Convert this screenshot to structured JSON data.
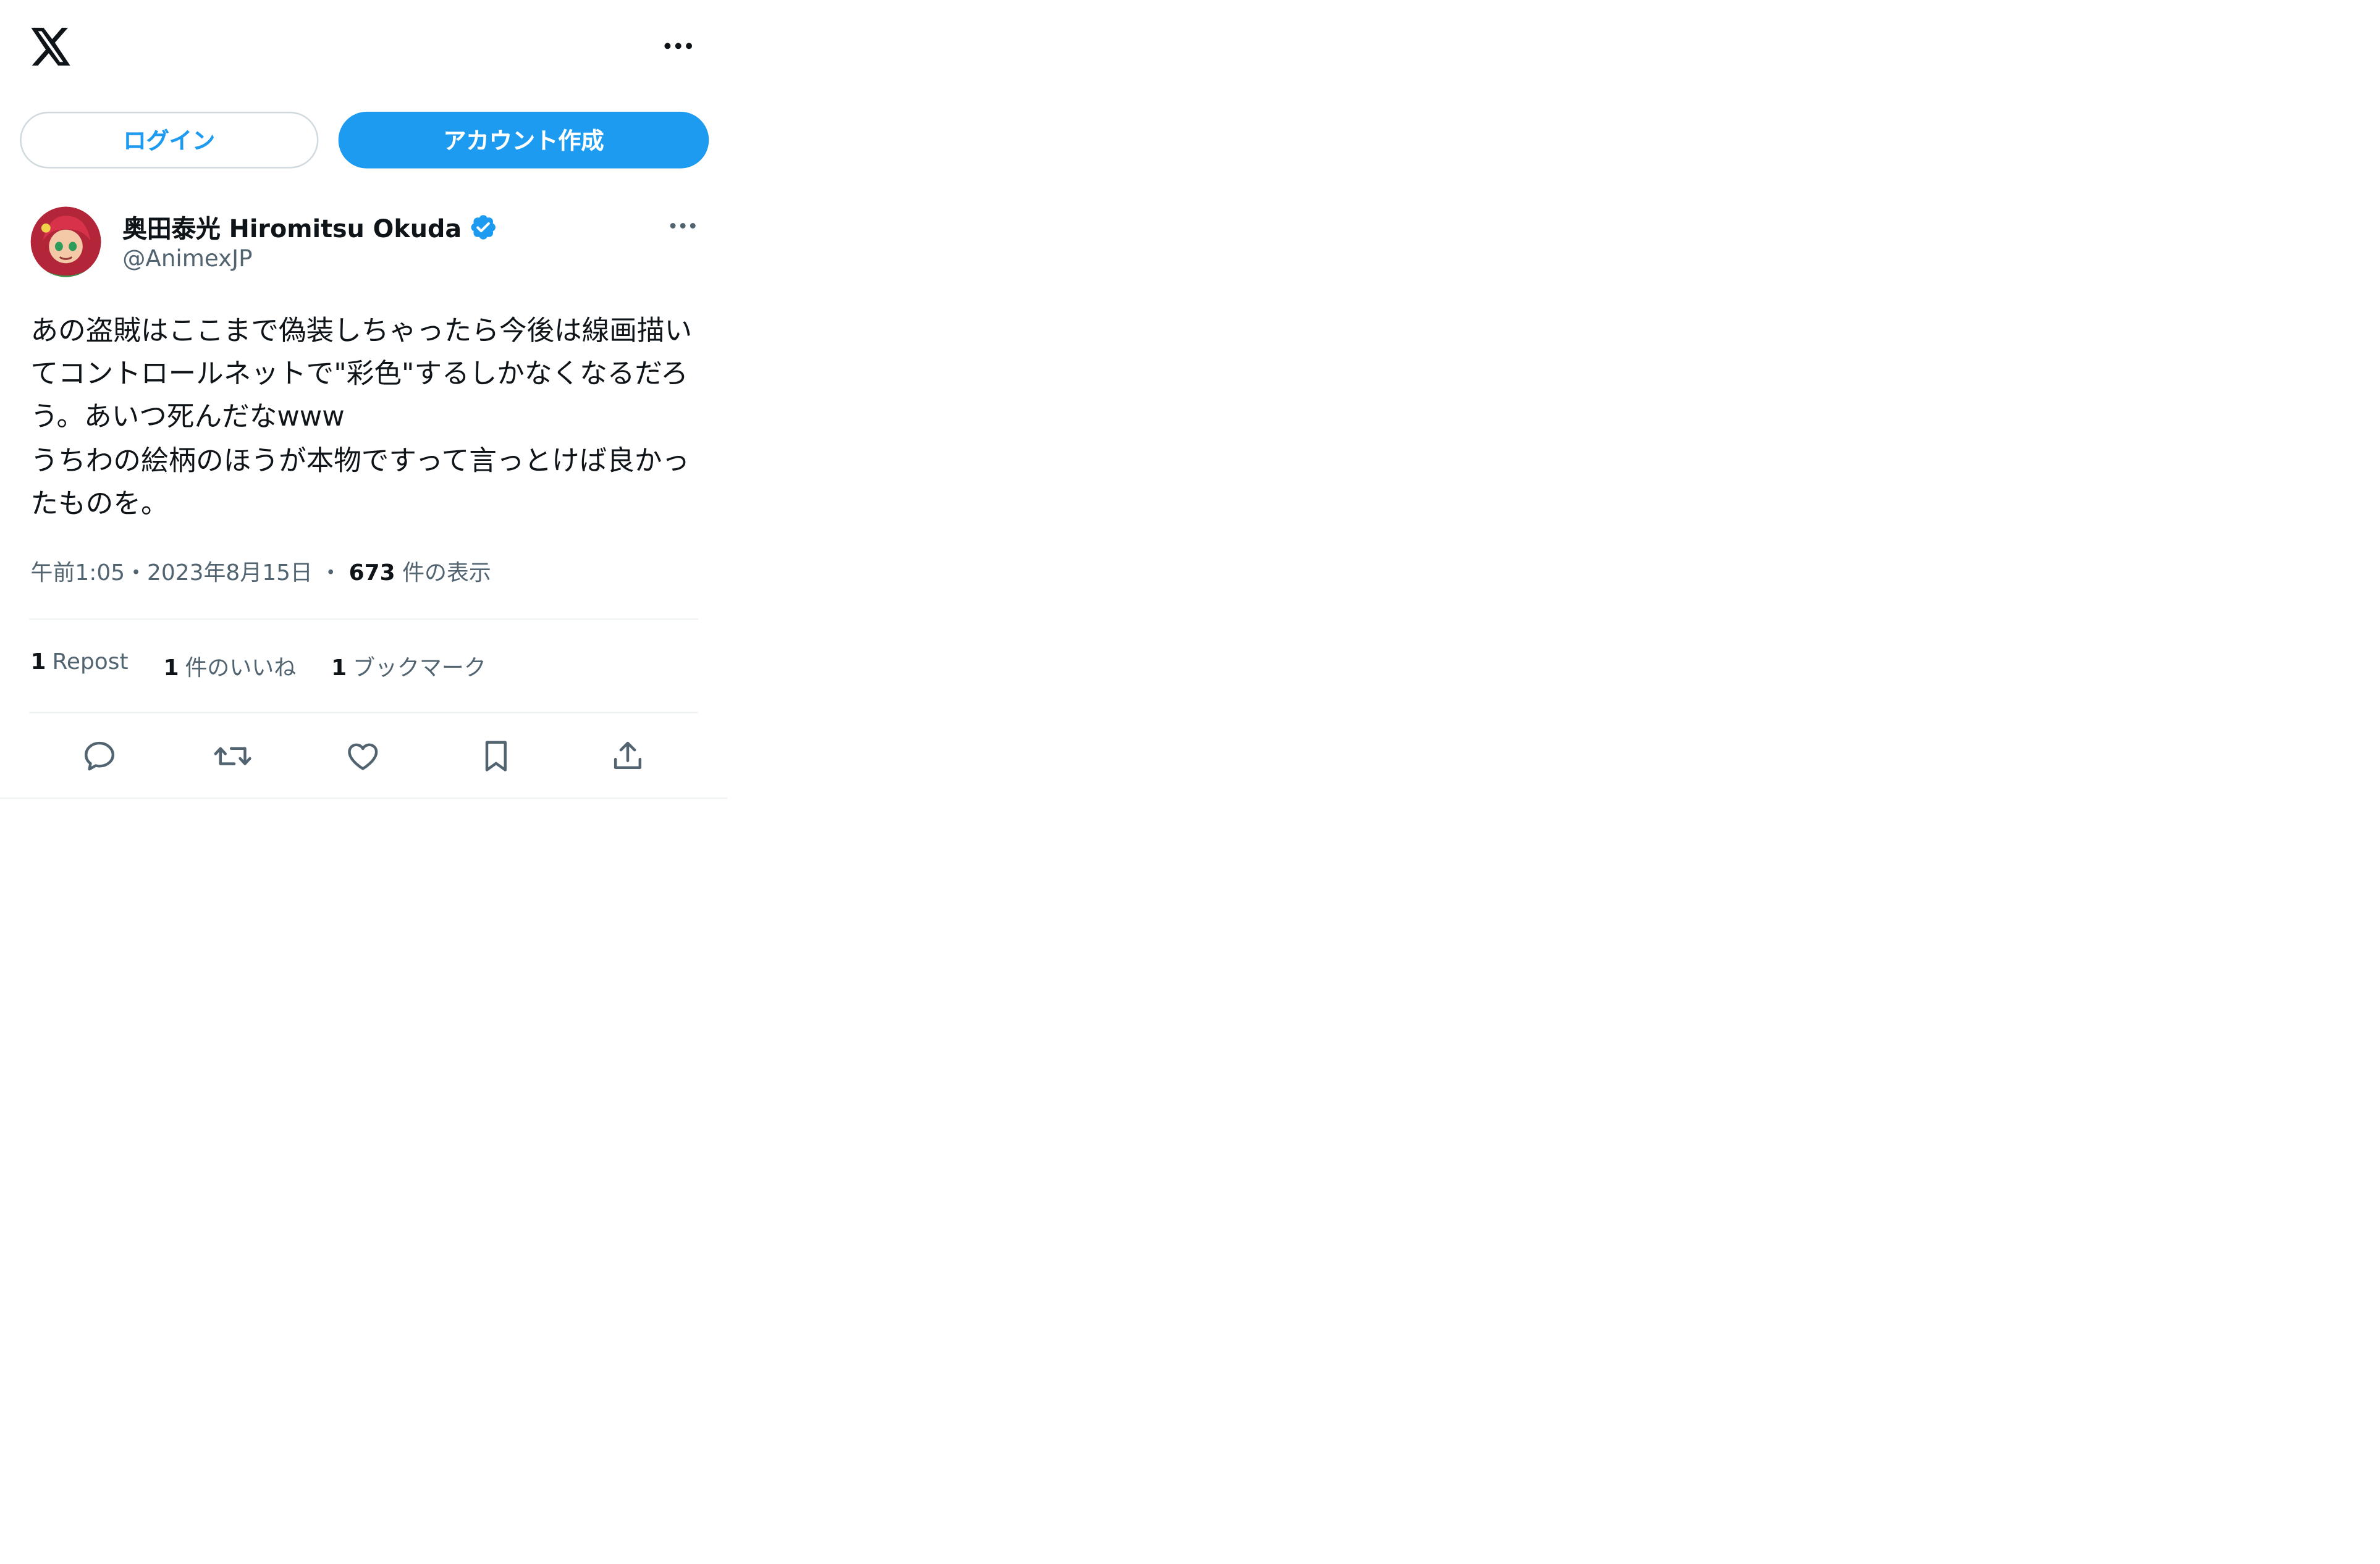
{
  "header": {
    "logo_icon": "x-logo-icon",
    "more_icon": "more-horizontal-icon"
  },
  "auth": {
    "login_label": "ログイン",
    "signup_label": "アカウント作成"
  },
  "post": {
    "author_name": "奥田泰光 Hiromitsu Okuda",
    "verified": true,
    "handle": "@AnimexJP",
    "text": "あの盗賊はここまで偽装しちゃったら今後は線画描いてコントロールネットで\"彩色\"するしかなくなるだろう。あいつ死んだなwww\nうちわの絵柄のほうが本物ですって言っとけば良かったものを。",
    "time": "午前1:05",
    "separator": "・",
    "date": "2023年8月15日",
    "views_count": "673",
    "views_label": "件の表示"
  },
  "stats": {
    "reposts": {
      "count": "1",
      "label": "Repost"
    },
    "likes": {
      "count": "1",
      "label": "件のいいね"
    },
    "bookmarks": {
      "count": "1",
      "label": "ブックマーク"
    }
  },
  "actions": [
    "reply-icon",
    "repost-icon",
    "like-icon",
    "bookmark-icon",
    "share-icon"
  ],
  "colors": {
    "accent": "#1d9bf0",
    "text": "#0f1419",
    "secondary": "#536471",
    "border": "#cfd9de",
    "divider": "#eff3f4"
  }
}
